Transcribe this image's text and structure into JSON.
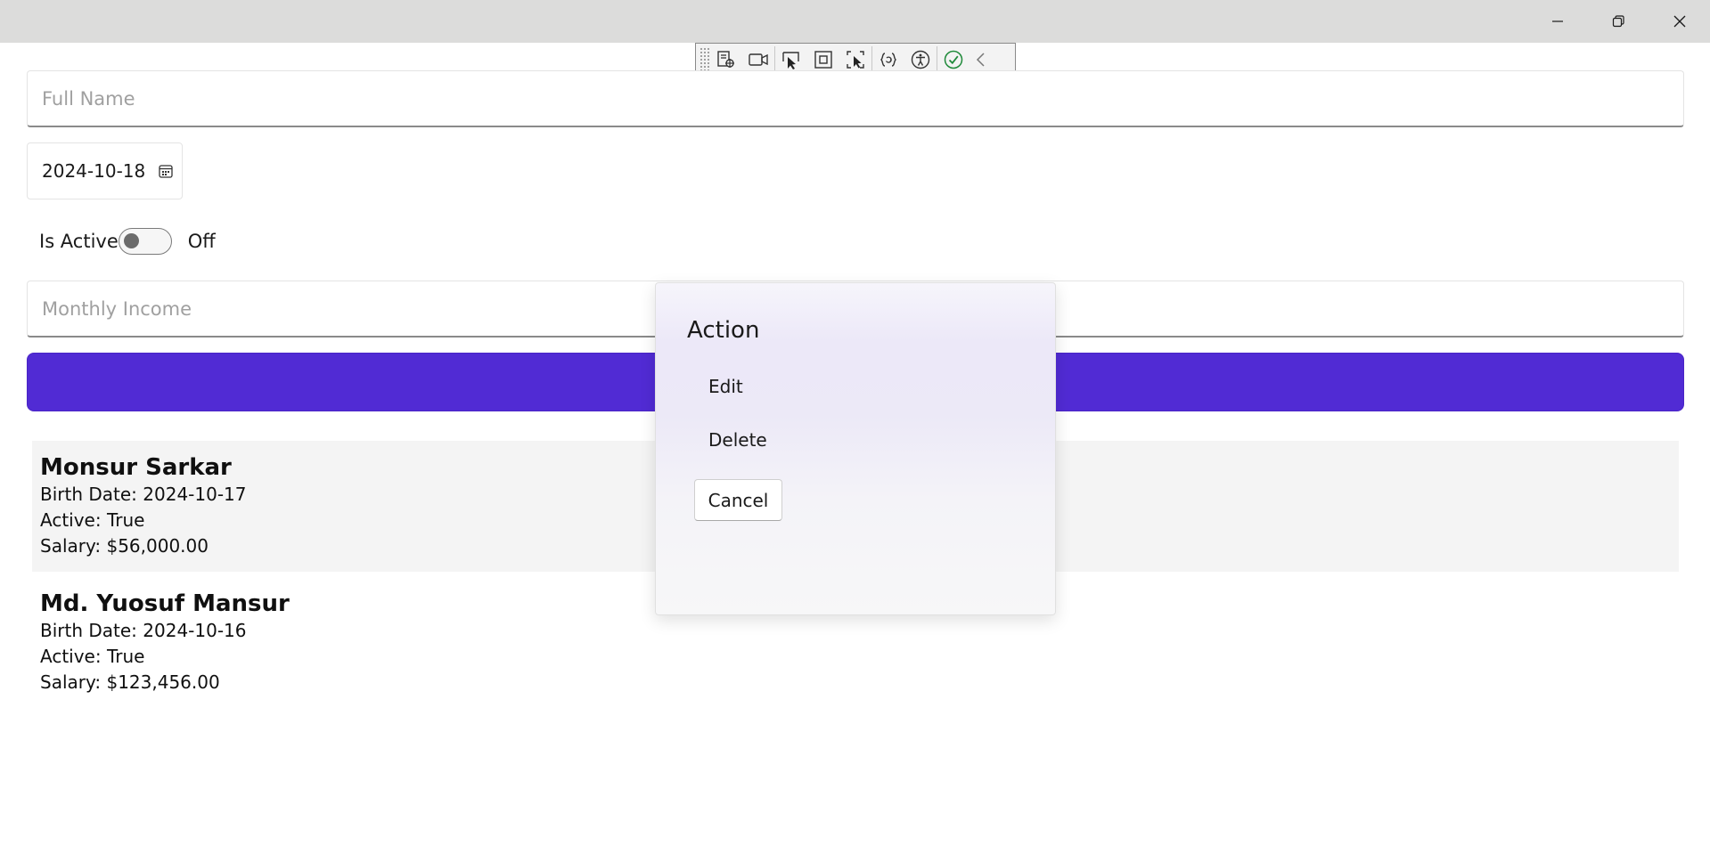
{
  "window": {
    "controls": {
      "minimize_icon": "minimize-icon",
      "maximize_icon": "restore-icon",
      "close_icon": "close-icon"
    }
  },
  "debug_toolbar": {
    "icons": [
      "live-visual-tree-icon",
      "record-video-icon",
      "select-element-icon",
      "display-layout-adorners-icon",
      "track-focus-icon",
      "hot-reload-icon",
      "accessibility-icon",
      "check-icon",
      "collapse-chevron-icon"
    ]
  },
  "form": {
    "full_name_placeholder": "Full Name",
    "birth_date_value": "2024-10-18",
    "is_active_label": "Is Active",
    "is_active_state": "Off",
    "monthly_income_placeholder": "Monthly Income",
    "accent_color": "#512bd4"
  },
  "records": [
    {
      "name": "Monsur Sarkar",
      "birth_date": "Birth Date: 2024-10-17",
      "active": "Active: True",
      "salary": "Salary: $56,000.00"
    },
    {
      "name": "Md. Yuosuf Mansur",
      "birth_date": "Birth Date: 2024-10-16",
      "active": "Active: True",
      "salary": "Salary: $123,456.00"
    }
  ],
  "action_sheet": {
    "title": "Action",
    "items": [
      "Edit",
      "Delete"
    ],
    "cancel_label": "Cancel"
  }
}
